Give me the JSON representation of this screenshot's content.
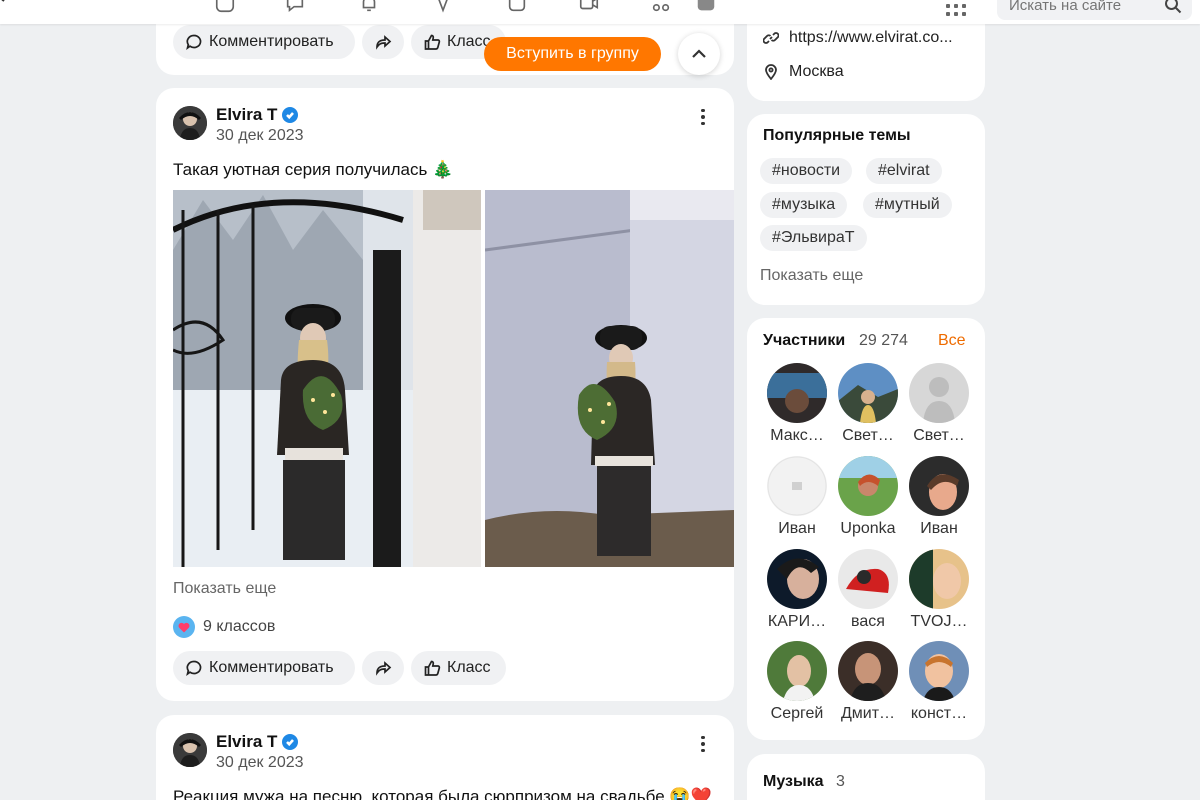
{
  "search": {
    "placeholder": "Искать на сайте"
  },
  "previous_post": {
    "actions": {
      "comment": "Комментировать",
      "like": "Класс"
    }
  },
  "floating": {
    "join_label": "Вступить в группу"
  },
  "post1": {
    "author": "Elvira T",
    "date": "30 дек 2023",
    "text": "Такая уютная серия получилась 🎄",
    "show_more": "Показать еще",
    "likes": "9 классов",
    "actions": {
      "comment": "Комментировать",
      "like": "Класс"
    }
  },
  "post2": {
    "author": "Elvira T",
    "date": "30 дек 2023",
    "text": "Реакция мужа на песню, которая была сюрпризом на свадьбе 😭❤️"
  },
  "group_info": {
    "website": "https://www.elvirat.co...",
    "city": "Москва"
  },
  "popular_topics": {
    "title": "Популярные темы",
    "tags": [
      "#новости",
      "#elvirat",
      "#музыка",
      "#мутный",
      "#ЭльвираТ"
    ],
    "show_more": "Показать еще"
  },
  "members": {
    "title": "Участники",
    "count": "29 274",
    "all_label": "Все",
    "list": [
      {
        "name": "Макс…"
      },
      {
        "name": "Свет…"
      },
      {
        "name": "Свет…"
      },
      {
        "name": "Иван"
      },
      {
        "name": "Uponka"
      },
      {
        "name": "Иван"
      },
      {
        "name": "КАРИ…"
      },
      {
        "name": "вася"
      },
      {
        "name": "TVOJ…"
      },
      {
        "name": "Сергей"
      },
      {
        "name": "Дмит…"
      },
      {
        "name": "конст…"
      }
    ]
  },
  "music": {
    "title": "Музыка",
    "count": "3"
  },
  "colors": {
    "accent": "#ff7700",
    "verified": "#1e88e5"
  }
}
